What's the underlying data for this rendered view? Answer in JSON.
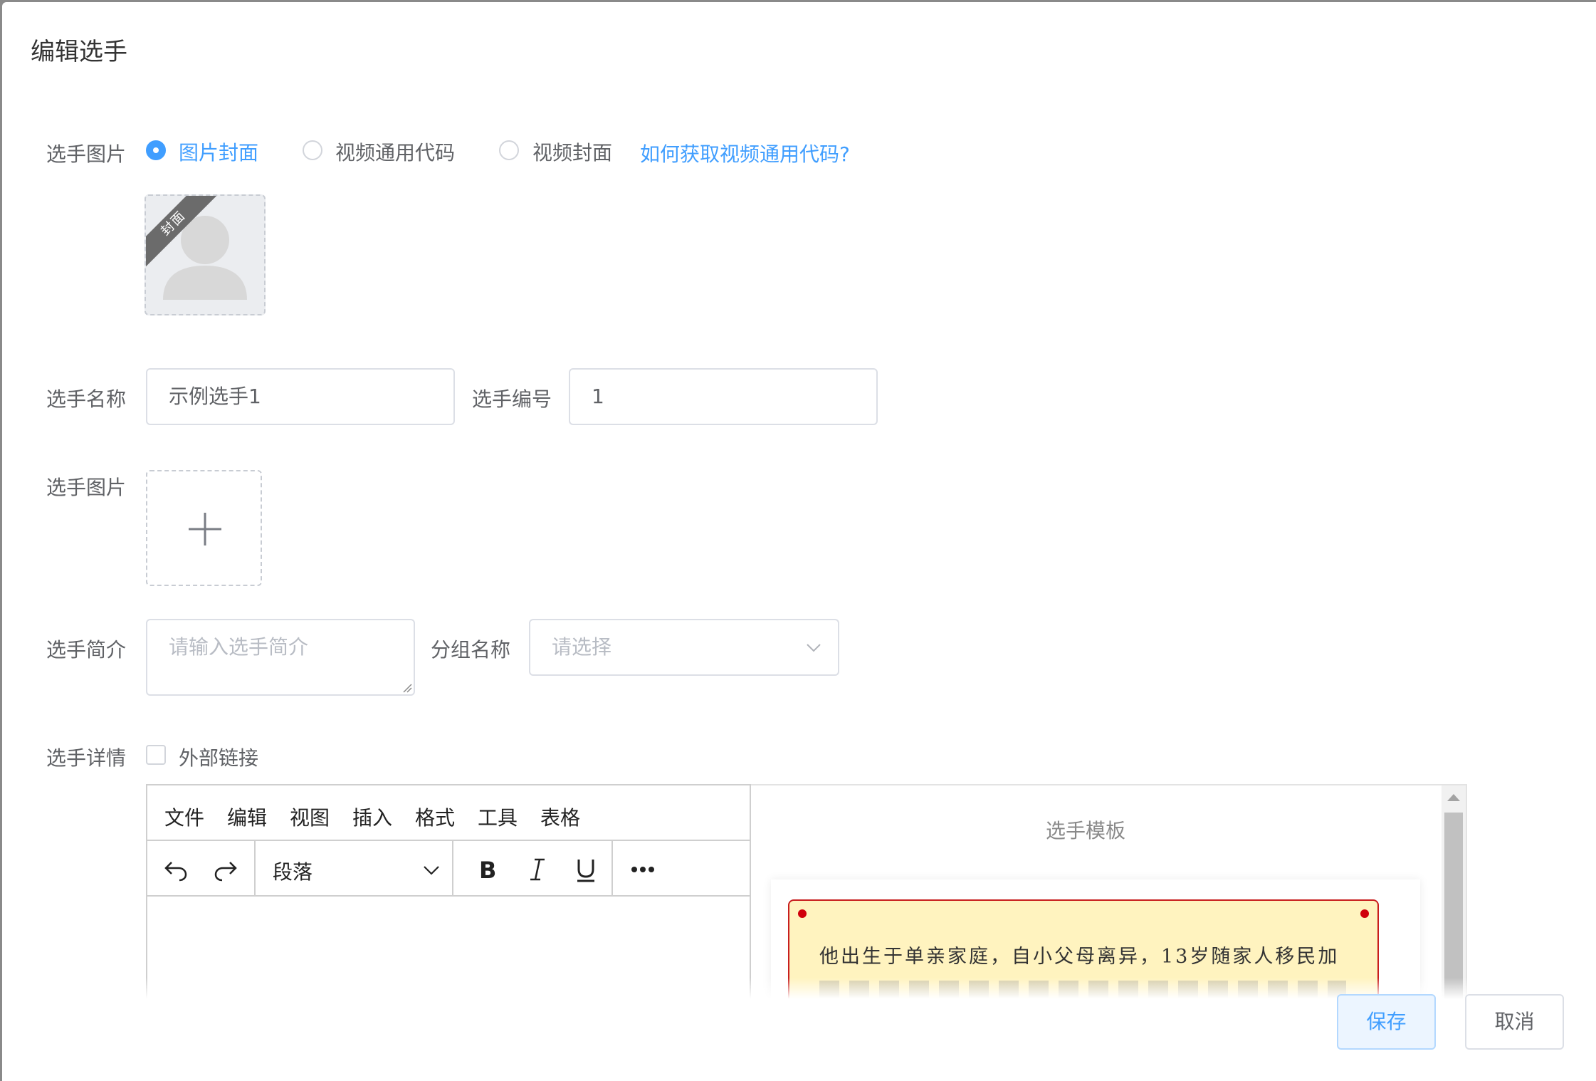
{
  "dialog": {
    "title": "编辑选手"
  },
  "cover": {
    "label": "选手图片",
    "options": [
      "图片封面",
      "视频通用代码",
      "视频封面"
    ],
    "selected": "图片封面",
    "help_link": "如何获取视频通用代码?",
    "ribbon": "封面"
  },
  "name": {
    "label": "选手名称",
    "value": "示例选手1"
  },
  "number": {
    "label": "选手编号",
    "value": "1"
  },
  "image": {
    "label": "选手图片"
  },
  "intro": {
    "label": "选手简介",
    "placeholder": "请输入选手简介"
  },
  "group": {
    "label": "分组名称",
    "placeholder": "请选择"
  },
  "detail": {
    "label": "选手详情",
    "external_link": "外部链接",
    "external_checked": false
  },
  "editor": {
    "menu": [
      "文件",
      "编辑",
      "视图",
      "插入",
      "格式",
      "工具",
      "表格"
    ],
    "block_format": "段落"
  },
  "preview": {
    "title": "选手模板",
    "text": "他出生于单亲家庭，自小父母离异，13岁随家人移民加"
  },
  "footer": {
    "save": "保存",
    "cancel": "取消"
  },
  "colors": {
    "primary": "#409eff",
    "template_bg": "#fff3bf",
    "template_border": "#c81e1e"
  }
}
